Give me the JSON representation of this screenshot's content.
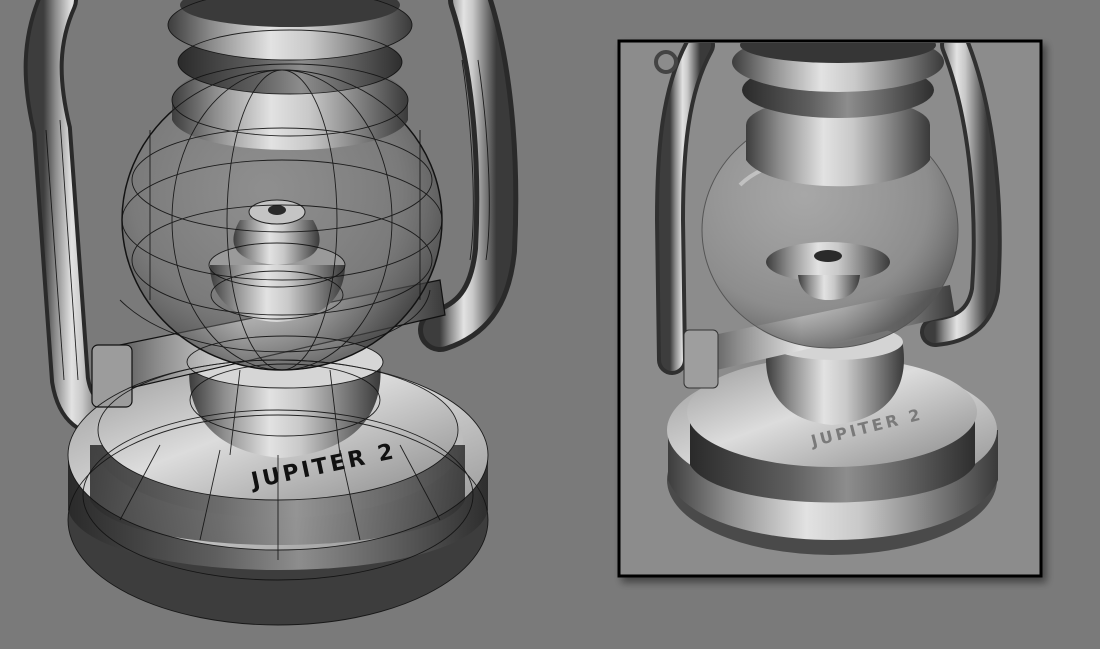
{
  "scene": {
    "background": "#7a7a7a",
    "viewport_left": {
      "mode": "wireframe-over-shaded",
      "engraving_text": "JUPITER 2",
      "metal_color": "#b8b8b8",
      "wire_color": "#111111",
      "glass_tint": "#9a9a9a"
    },
    "viewport_right": {
      "mode": "shaded-render",
      "engraving_text": "JUPITER 2",
      "frame_color": "#000000",
      "metal_color": "#a8a8a8"
    }
  }
}
